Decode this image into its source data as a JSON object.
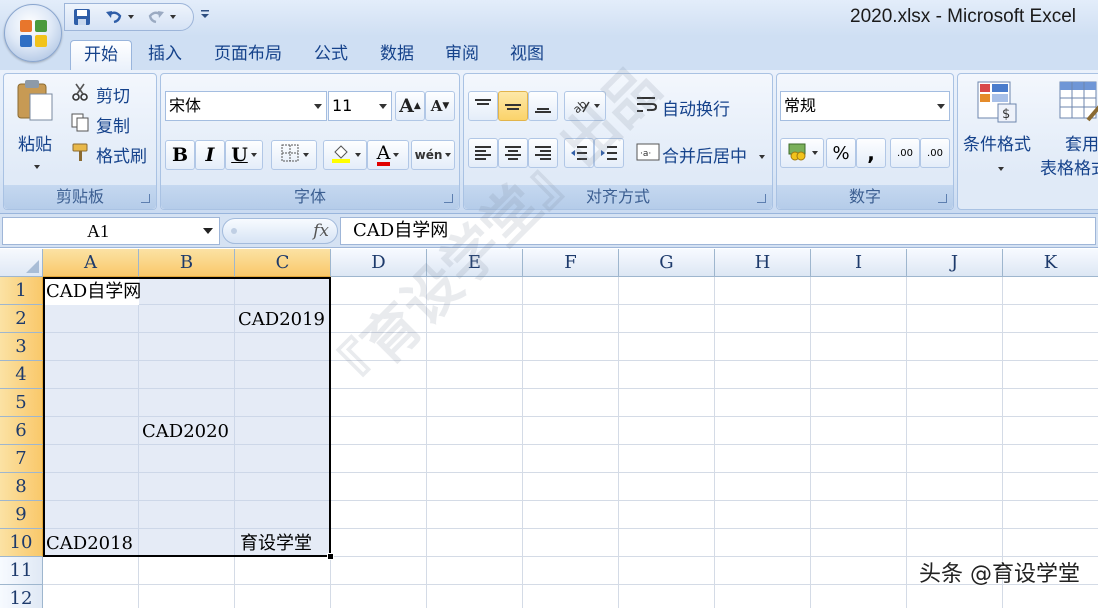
{
  "window": {
    "title": "2020.xlsx - Microsoft Excel"
  },
  "tabs": [
    {
      "label": "开始",
      "active": true
    },
    {
      "label": "插入"
    },
    {
      "label": "页面布局"
    },
    {
      "label": "公式"
    },
    {
      "label": "数据"
    },
    {
      "label": "审阅"
    },
    {
      "label": "视图"
    }
  ],
  "ribbon": {
    "clipboard": {
      "label": "剪贴板",
      "paste": "粘贴",
      "cut": "剪切",
      "copy": "复制",
      "format_painter": "格式刷"
    },
    "font": {
      "label": "字体",
      "font_name": "宋体",
      "font_size": "11",
      "bold": "B",
      "italic": "I",
      "underline": "U",
      "font_color_glyph": "A",
      "grow_glyph": "A",
      "shrink_glyph": "A",
      "phonetic_glyph": "wén"
    },
    "alignment": {
      "label": "对齐方式",
      "wrap_text": "自动换行",
      "merge_center": "合并后居中"
    },
    "number": {
      "label": "数字",
      "format": "常规",
      "percent": "%",
      "comma": ",",
      "inc_decimal": ".00",
      "dec_decimal": ".00"
    },
    "styles": {
      "conditional_format": "条件格式",
      "table_format_line1": "套用",
      "table_format_line2": "表格格式"
    }
  },
  "formula_bar": {
    "name_box": "A1",
    "fx": "fx",
    "content": "CAD自学网"
  },
  "grid": {
    "columns": [
      "A",
      "B",
      "C",
      "D",
      "E",
      "F",
      "G",
      "H",
      "I",
      "J",
      "K"
    ],
    "rows": [
      "1",
      "2",
      "3",
      "4",
      "5",
      "6",
      "7",
      "8",
      "9",
      "10",
      "11",
      "12"
    ],
    "cells": {
      "A1": "CAD自学网",
      "C2": "CAD2019",
      "B6": "CAD2020",
      "A10": "CAD2018",
      "C10": "育设学堂"
    }
  },
  "watermarks": {
    "center": "『育设学堂』出品",
    "corner": "头条 @育设学堂"
  },
  "colors": {
    "accent": "#15428b",
    "selection_header": "#f9c86a",
    "font_color": "#e00000",
    "highlight_color": "#ffff00"
  }
}
